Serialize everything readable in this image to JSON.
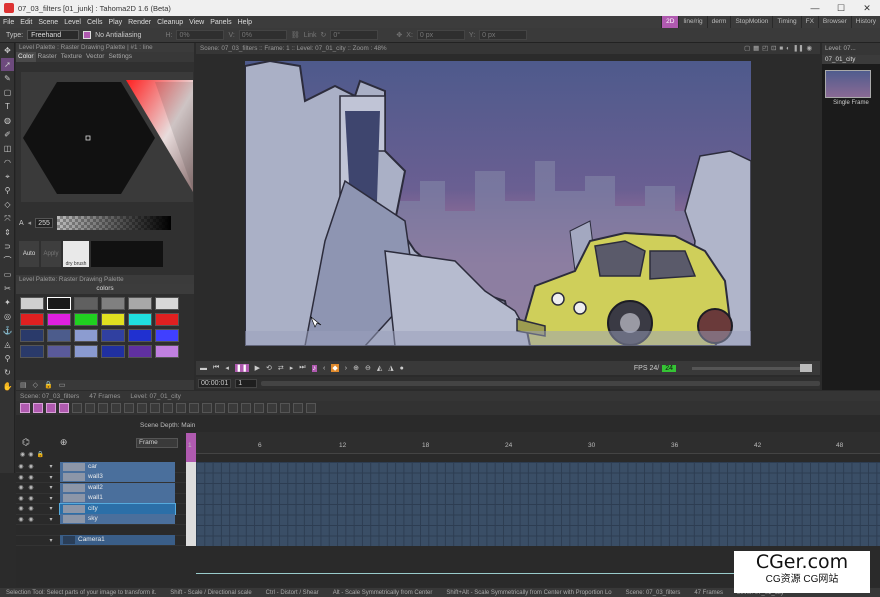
{
  "window": {
    "title": "07_03_filters [01_junk] : Tahoma2D 1.6 (Beta)",
    "min": "—",
    "max": "☐",
    "close": "✕"
  },
  "menu": [
    "File",
    "Edit",
    "Scene",
    "Level",
    "Cells",
    "Play",
    "Render",
    "Cleanup",
    "View",
    "Panels",
    "Help"
  ],
  "rooms": [
    {
      "label": "2D",
      "active": true
    },
    {
      "label": "line/rig",
      "active": false
    },
    {
      "label": "derm",
      "active": false
    },
    {
      "label": "StopMotion",
      "active": false
    },
    {
      "label": "Timing",
      "active": false
    },
    {
      "label": "FX",
      "active": false
    },
    {
      "label": "Browser",
      "active": false
    },
    {
      "label": "History",
      "active": false
    }
  ],
  "tool_options": {
    "type_label": "Type:",
    "type_value": "Freehand",
    "antialias_label": "No Antialiasing",
    "h_label": "H:",
    "h_value": "0%",
    "v_label": "V:",
    "v_value": "0%",
    "rot_value": "0°",
    "link_label": "Link",
    "x_label": "X:",
    "x_value": "0 px",
    "y_label": "Y:",
    "y_value": "0 px"
  },
  "style_editor": {
    "title": "Level Palette : Raster Drawing Palette | #1 : line",
    "tabs": [
      "Color",
      "Raster",
      "Texture",
      "Vector",
      "Settings"
    ],
    "alpha_label": "A",
    "alpha_value": "255",
    "auto_label": "Auto",
    "apply_label": "Apply",
    "brush_name": "dry brush"
  },
  "palette": {
    "title": "Level Palette: Raster Drawing Palette",
    "page_name": "colors",
    "chips": [
      "#cfcfcf",
      "#1a1a1a",
      "#606060",
      "#808080",
      "#a8a8a8",
      "#d8d8d8",
      "#e02020",
      "#e020e0",
      "#20d020",
      "#e0e020",
      "#20e0e0",
      "#e02020",
      "#2a3a6a",
      "#4c5c8c",
      "#8c9cd0",
      "#3040a0",
      "#2030d0",
      "#4040ff",
      "#2a3a6a",
      "#5a5a9a",
      "#8a9ad0",
      "#2030a0",
      "#6030a0",
      "#c080e0"
    ]
  },
  "viewer": {
    "header": "Scene: 07_03_filters  ::  Frame: 1  ::  Level: 07_01_city  ::  Zoom : 48%",
    "fps_label": "FPS 24/",
    "fps_value": "24",
    "timecode": "00:00:01",
    "frame": "1"
  },
  "level_strip": {
    "title": "Level: 07...",
    "level": "07_01_city",
    "thumb_label": "Single Frame"
  },
  "xsheet": {
    "header": [
      "Scene: 07_03_filters",
      "47 Frames",
      "Level: 07_01_city"
    ],
    "scene_depth": "Scene Depth: Main",
    "frame_mode": "Frame",
    "ruler": [
      "1",
      "6",
      "12",
      "18",
      "24",
      "30",
      "36",
      "42",
      "48"
    ],
    "layers": [
      {
        "name": "car",
        "hl": false
      },
      {
        "name": "wall3",
        "hl": false
      },
      {
        "name": "wall2",
        "hl": false
      },
      {
        "name": "wall1",
        "hl": false
      },
      {
        "name": "city",
        "hl": true
      },
      {
        "name": "sky",
        "hl": false
      }
    ],
    "camera": "Camera1"
  },
  "status": [
    "Selection Tool: Select parts of your image to transform it.",
    "Shift - Scale / Directional scale",
    "Ctrl - Distort / Shear",
    "Alt - Scale Symmetrically from Center",
    "Shift+Alt - Scale Symmetrically from Center with Proportion Lo",
    "Scene: 07_03_filters",
    "47 Frames",
    "Level: 07_01_city"
  ],
  "watermark": {
    "main": "CGer.com",
    "sub": "CG资源 CG网站"
  },
  "colors": {
    "accent": "#b05ab0",
    "fps_green": "#35c435",
    "layer_blue": "#4a6f9c",
    "sky_top": "#4e5a8c",
    "sky_bottom": "#c07aa0"
  }
}
